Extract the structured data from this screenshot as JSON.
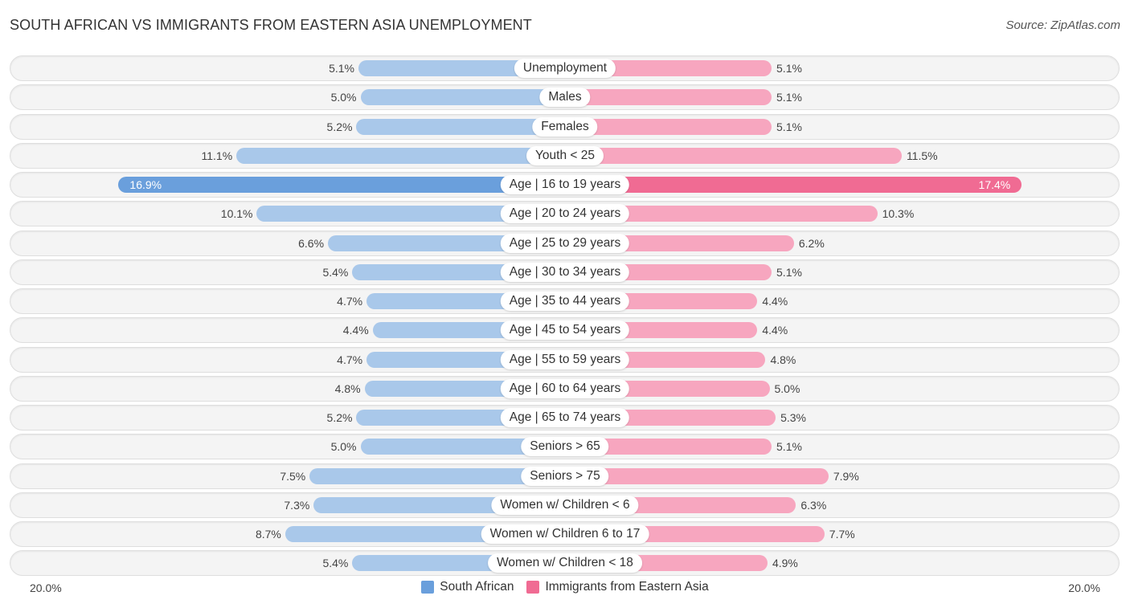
{
  "header": {
    "title": "SOUTH AFRICAN VS IMMIGRANTS FROM EASTERN ASIA UNEMPLOYMENT",
    "source": "Source: ZipAtlas.com"
  },
  "colors": {
    "south_african": "#a9c8ea",
    "south_african_strong": "#6a9fdc",
    "immigrants": "#f7a6bf",
    "immigrants_strong": "#f06b93",
    "legend_south_african": "#6a9fdc",
    "legend_immigrants": "#f06b93"
  },
  "chart_data": {
    "type": "bar",
    "orientation": "horizontal-diverging",
    "title": "SOUTH AFRICAN VS IMMIGRANTS FROM EASTERN ASIA UNEMPLOYMENT",
    "xlabel": "",
    "ylabel": "",
    "xlim": [
      -20,
      20
    ],
    "axis_labels": {
      "left": "20.0%",
      "right": "20.0%"
    },
    "legend": {
      "position": "bottom-center",
      "entries": [
        "South African",
        "Immigrants from Eastern Asia"
      ]
    },
    "categories": [
      "Unemployment",
      "Males",
      "Females",
      "Youth < 25",
      "Age | 16 to 19 years",
      "Age | 20 to 24 years",
      "Age | 25 to 29 years",
      "Age | 30 to 34 years",
      "Age | 35 to 44 years",
      "Age | 45 to 54 years",
      "Age | 55 to 59 years",
      "Age | 60 to 64 years",
      "Age | 65 to 74 years",
      "Seniors > 65",
      "Seniors > 75",
      "Women w/ Children < 6",
      "Women w/ Children 6 to 17",
      "Women w/ Children < 18"
    ],
    "series": [
      {
        "name": "South African",
        "side": "left",
        "values": [
          5.1,
          5.0,
          5.2,
          11.1,
          16.9,
          10.1,
          6.6,
          5.4,
          4.7,
          4.4,
          4.7,
          4.8,
          5.2,
          5.0,
          7.5,
          7.3,
          8.7,
          5.4
        ],
        "labels": [
          "5.1%",
          "5.0%",
          "5.2%",
          "11.1%",
          "16.9%",
          "10.1%",
          "6.6%",
          "5.4%",
          "4.7%",
          "4.4%",
          "4.7%",
          "4.8%",
          "5.2%",
          "5.0%",
          "7.5%",
          "7.3%",
          "8.7%",
          "5.4%"
        ]
      },
      {
        "name": "Immigrants from Eastern Asia",
        "side": "right",
        "values": [
          5.1,
          5.1,
          5.1,
          11.5,
          17.4,
          10.3,
          6.2,
          5.1,
          4.4,
          4.4,
          4.8,
          5.0,
          5.3,
          5.1,
          7.9,
          6.3,
          7.7,
          4.9
        ],
        "labels": [
          "5.1%",
          "5.1%",
          "5.1%",
          "11.5%",
          "17.4%",
          "10.3%",
          "6.2%",
          "5.1%",
          "4.4%",
          "4.4%",
          "4.8%",
          "5.0%",
          "5.3%",
          "5.1%",
          "7.9%",
          "6.3%",
          "7.7%",
          "4.9%"
        ]
      }
    ],
    "highlighted_category": "Age | 16 to 19 years"
  }
}
